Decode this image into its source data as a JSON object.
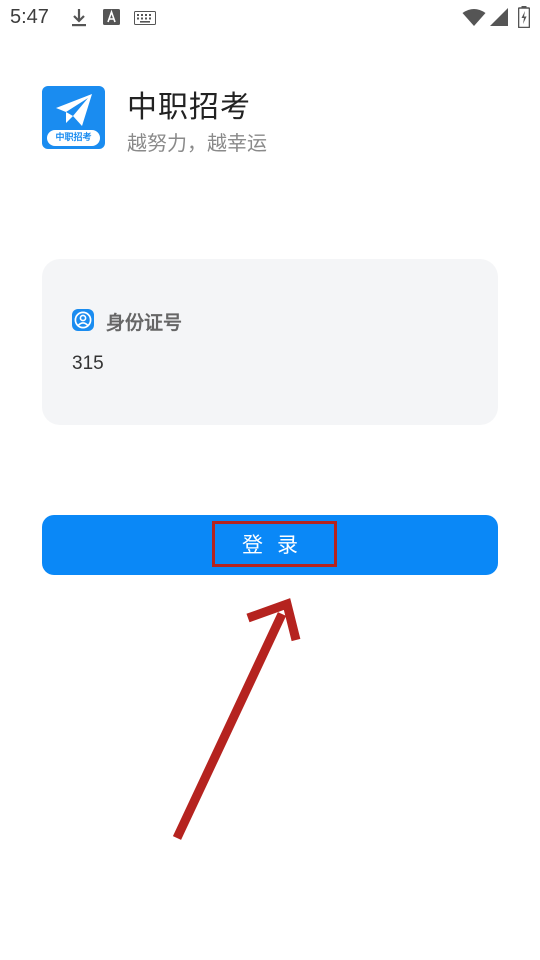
{
  "status_bar": {
    "time": "5:47",
    "icons": [
      "download-icon",
      "text-a-icon",
      "keyboard-icon",
      "wifi-icon",
      "signal-icon",
      "battery-charging-icon"
    ]
  },
  "app": {
    "logo_caption": "中职招考",
    "title": "中职招考",
    "slogan": "越努力，越幸运",
    "brand_color": "#0a88f7"
  },
  "form": {
    "id_label": "身份证号",
    "id_value": "315"
  },
  "login": {
    "label": "登录"
  },
  "annotation": {
    "color": "#b5231f"
  }
}
